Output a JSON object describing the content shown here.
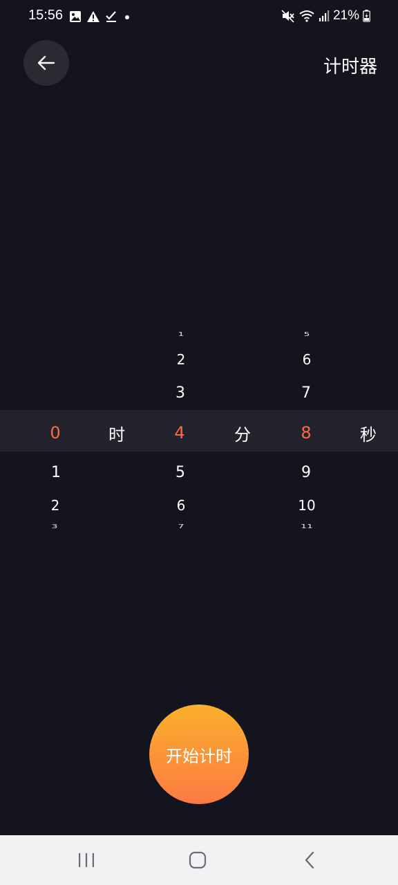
{
  "status_bar": {
    "time": "15:56",
    "battery": "21%",
    "left_icons": [
      "image-icon",
      "warning-icon",
      "check-icon",
      "dot-icon"
    ],
    "right_icons": [
      "mute-icon",
      "wifi-icon",
      "signal-icon",
      "battery-charging-icon"
    ]
  },
  "header": {
    "title": "计时器",
    "back_icon": "arrow-left-icon"
  },
  "picker": {
    "hours": {
      "unit": "时",
      "selected": "0",
      "below": [
        "1",
        "2",
        "3"
      ]
    },
    "minutes": {
      "unit": "分",
      "above": [
        "1",
        "2",
        "3"
      ],
      "selected": "4",
      "below": [
        "5",
        "6",
        "7"
      ]
    },
    "seconds": {
      "unit": "秒",
      "above": [
        "5",
        "6",
        "7"
      ],
      "selected": "8",
      "below": [
        "9",
        "10",
        "11"
      ]
    }
  },
  "start_button": {
    "label": "开始计时"
  },
  "colors": {
    "background": "#14141f",
    "selected_value": "#ff6a3d",
    "highlight_band": "#22232c",
    "button_gradient_top": "#f9b02c",
    "button_gradient_bottom": "#fd7a43"
  },
  "nav_bar": {
    "buttons": [
      "recent-apps-icon",
      "home-icon",
      "back-nav-icon"
    ]
  }
}
